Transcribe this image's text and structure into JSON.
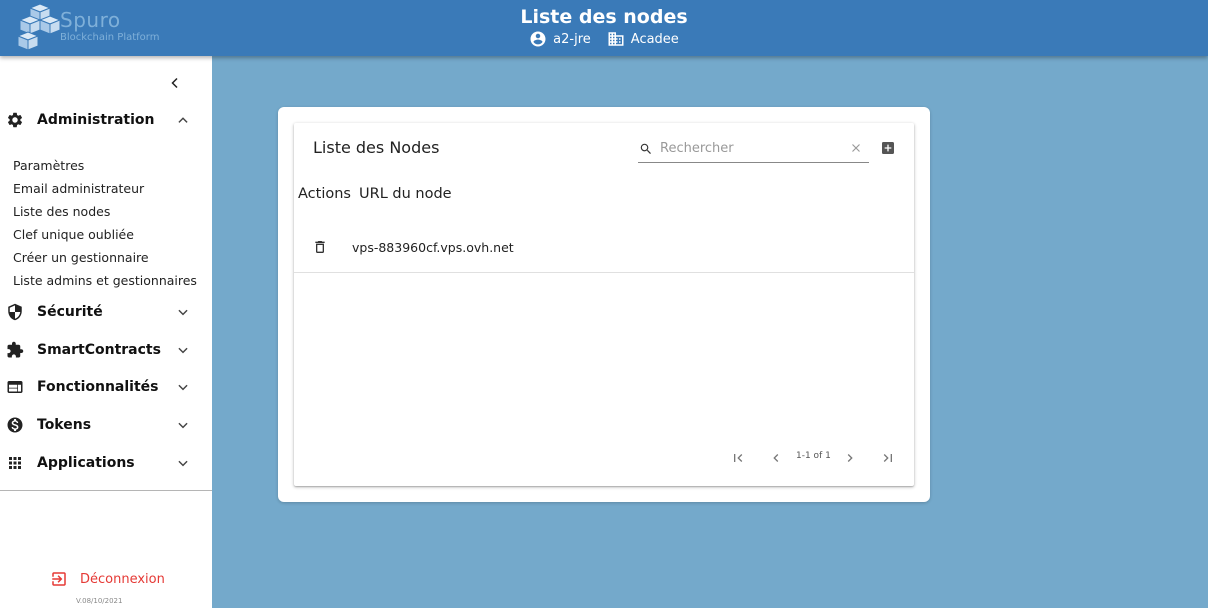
{
  "header": {
    "logo_name": "Spuro",
    "logo_tagline": "Blockchain Platform",
    "title": "Liste des nodes",
    "user": "a2-jre",
    "organization": "Acadee",
    "brand_color": "#3a7ab8"
  },
  "sidebar": {
    "sections": [
      {
        "label": "Administration",
        "icon": "gear-icon",
        "expanded": true
      },
      {
        "label": "Sécurité",
        "icon": "shield-icon",
        "expanded": false
      },
      {
        "label": "SmartContracts",
        "icon": "puzzle-icon",
        "expanded": false
      },
      {
        "label": "Fonctionnalités",
        "icon": "web-window-icon",
        "expanded": false
      },
      {
        "label": "Tokens",
        "icon": "dollar-circle-icon",
        "expanded": false
      },
      {
        "label": "Applications",
        "icon": "apps-grid-icon",
        "expanded": false
      }
    ],
    "admin_items": [
      "Paramètres",
      "Email administrateur",
      "Liste des nodes",
      "Clef unique oubliée",
      "Créer un gestionnaire",
      "Liste admins et gestionnaires"
    ],
    "logout_label": "Déconnexion",
    "version": "V.08/10/2021",
    "logout_color": "#e53935"
  },
  "main": {
    "card_title": "Liste des Nodes",
    "search_placeholder": "Rechercher",
    "search_value": "",
    "columns": [
      "Actions",
      "URL du node"
    ],
    "rows": [
      {
        "url": "vps-883960cf.vps.ovh.net"
      }
    ],
    "pagination": "1-1 of 1"
  }
}
